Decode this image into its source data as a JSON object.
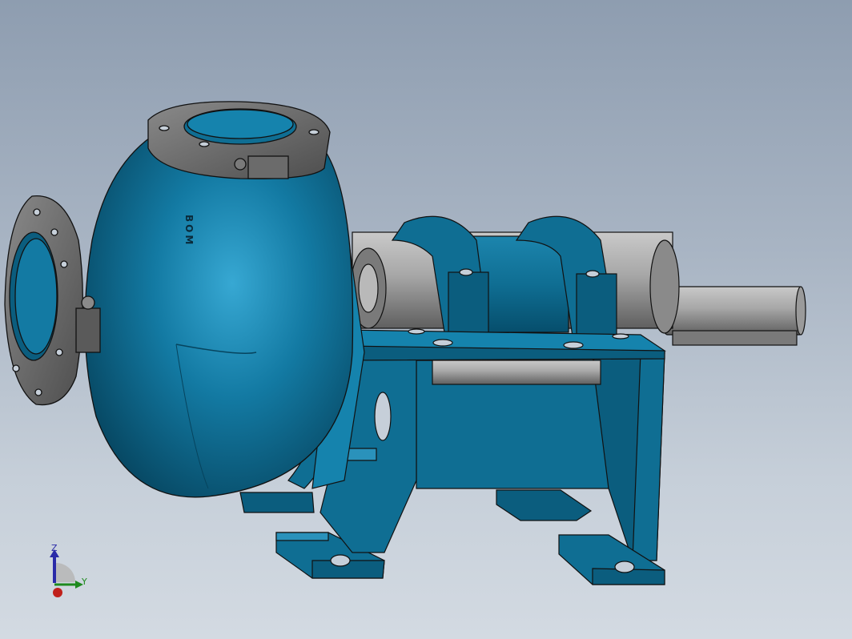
{
  "viewport": {
    "model": "centrifugal-slurry-pump-assembly",
    "engraving": "BOM",
    "colors": {
      "background_top": "#8e9db0",
      "background_bottom": "#d3dae2",
      "casing_blue": "#0f6e93",
      "casing_highlight": "#2a9cc7",
      "casing_shadow": "#06445e",
      "steel_gray": "#8c8c8c",
      "flange_gray": "#6b6b6b",
      "edge": "#1b1b1b"
    }
  },
  "triad": {
    "z_label": "Z",
    "y_label": "Y",
    "z_color": "#2a2aa8",
    "y_color": "#1e8a1e",
    "x_color": "#c0201b"
  }
}
